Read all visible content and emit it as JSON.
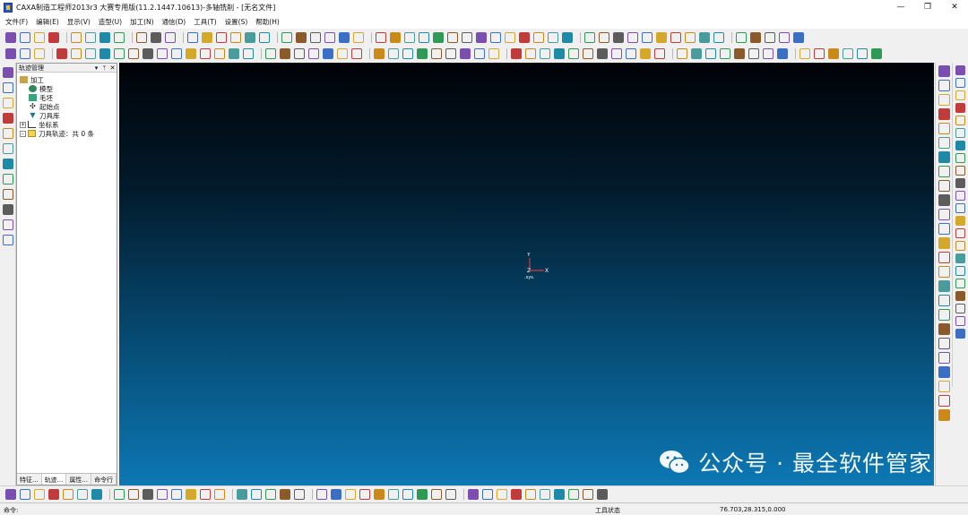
{
  "titlebar": {
    "title": "CAXA制造工程师2013r3 大赛专用版(11.2.1447.10613)-多轴铣削 - [无名文件]",
    "minimize": "—",
    "maximize": "❐",
    "close": "✕"
  },
  "menu": [
    "文件(F)",
    "编辑(E)",
    "显示(V)",
    "造型(U)",
    "加工(N)",
    "通信(D)",
    "工具(T)",
    "设置(S)",
    "帮助(H)"
  ],
  "panel": {
    "title": "轨迹管理",
    "pin": "▾",
    "dock": "ᛘ",
    "close": "✕",
    "tree": [
      {
        "label": "加工",
        "icon": "machining-icon",
        "indent": 0,
        "expander": ""
      },
      {
        "label": "模型",
        "icon": "model-icon",
        "indent": 1,
        "expander": ""
      },
      {
        "label": "毛坯",
        "icon": "blank-icon",
        "indent": 1,
        "expander": ""
      },
      {
        "label": "起始点",
        "icon": "start-point-icon",
        "indent": 1,
        "expander": ""
      },
      {
        "label": "刀具库",
        "icon": "tool-library-icon",
        "indent": 1,
        "expander": ""
      },
      {
        "label": "坐标系",
        "icon": "coordinate-system-icon",
        "indent": 0,
        "expander": "+"
      },
      {
        "label": "刀具轨迹：共 0 条",
        "icon": "toolpath-folder-icon",
        "indent": 0,
        "expander": "-"
      }
    ],
    "tabs": [
      "特征...",
      "轨迹...",
      "属性...",
      "命令行"
    ],
    "active_tab": "轨迹..."
  },
  "viewport": {
    "axis_y": "Y",
    "axis_x": "X",
    "axis_z": "Z",
    "axis_sys": ".sys.",
    "watermark": "公众号 · 最全软件管家"
  },
  "status": {
    "command_label": "命令:",
    "tool_status": "工具状态",
    "coordinates": "76.703,28.315,0.000"
  },
  "colors": {
    "viewport_top": "#000307",
    "viewport_bottom": "#0d78b4"
  }
}
